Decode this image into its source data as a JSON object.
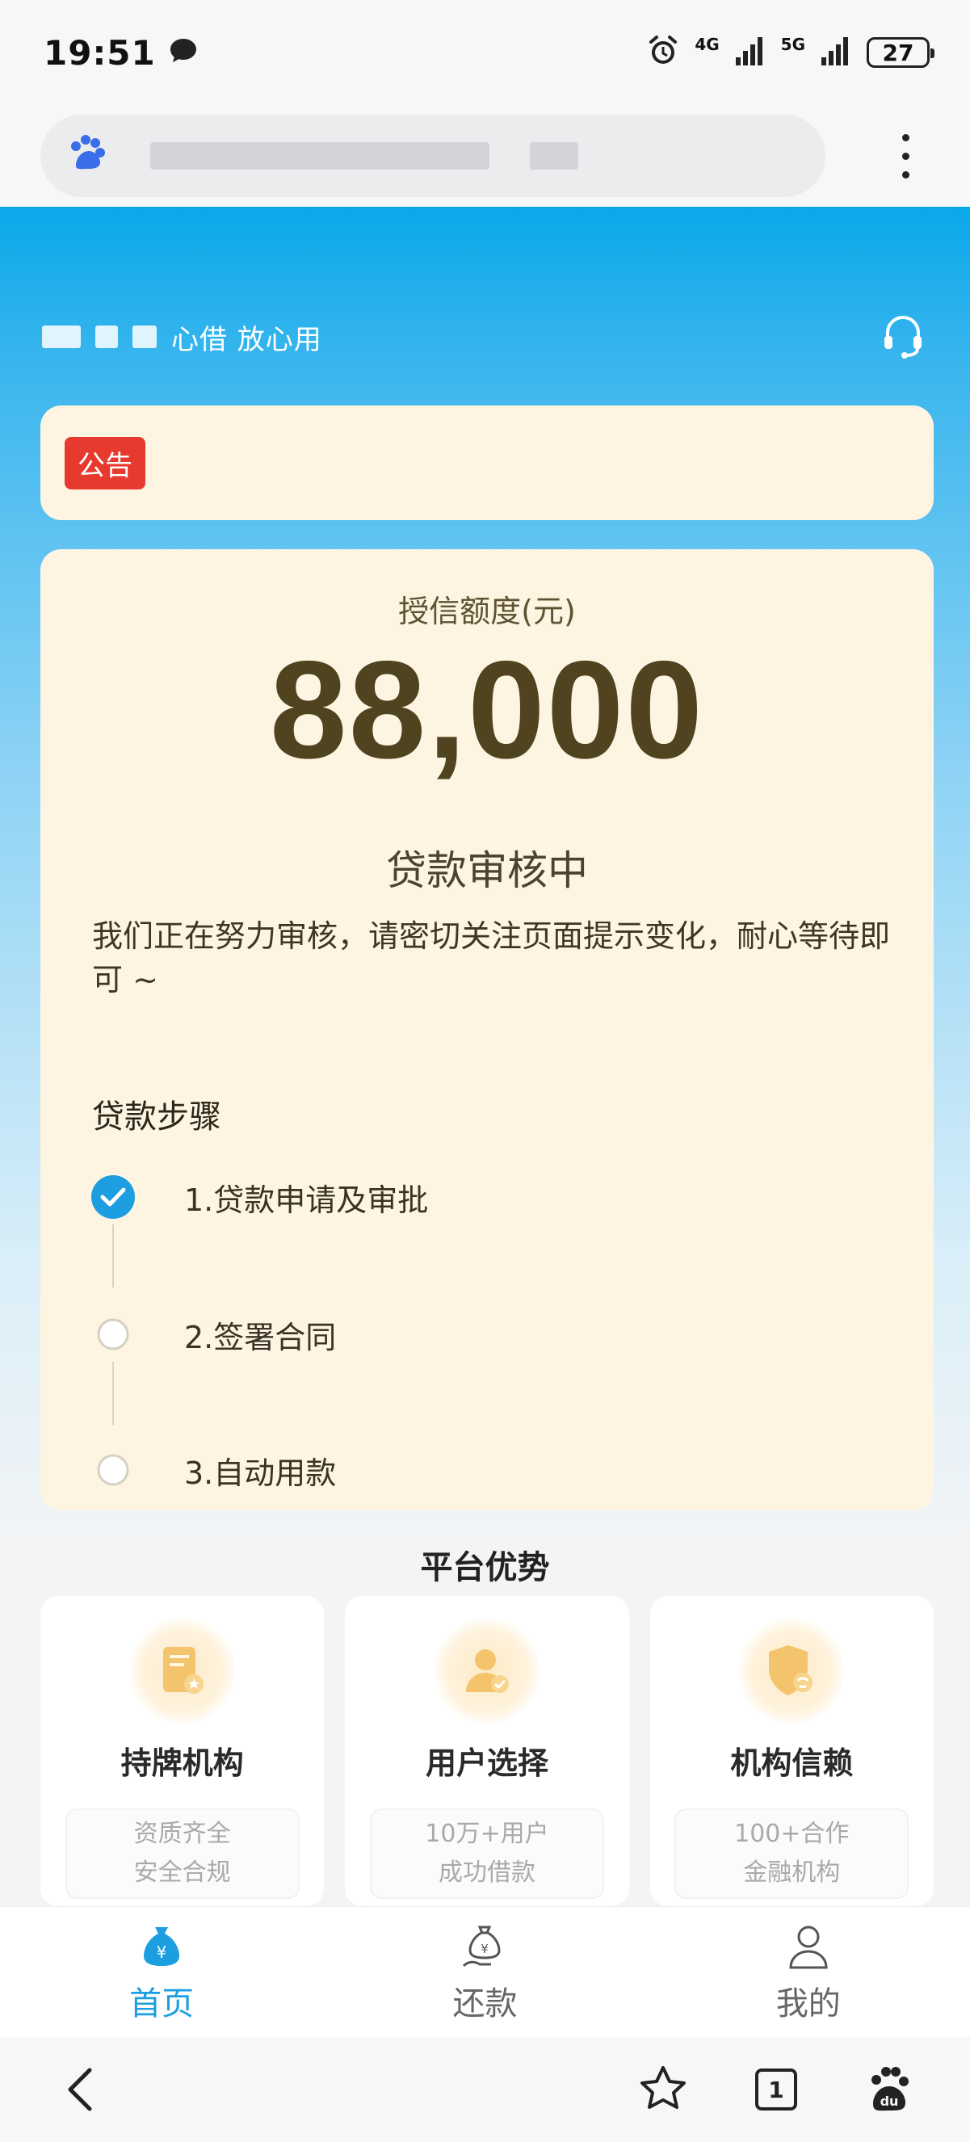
{
  "status_bar": {
    "time": "19:51",
    "net1": "4G",
    "net2": "5G",
    "battery": "27"
  },
  "header": {
    "slogan": "心借 放心用"
  },
  "notice": {
    "tag": "公告"
  },
  "loan": {
    "credit_label": "授信额度(元)",
    "credit_amount": "88,000",
    "review_title": "贷款审核中",
    "review_desc": "我们正在努力审核，请密切关注页面提示变化，耐心等待即可 ~",
    "steps_title": "贷款步骤",
    "steps": [
      {
        "label": "1.贷款申请及审批",
        "done": true
      },
      {
        "label": "2.签署合同",
        "done": false
      },
      {
        "label": "3.自动用款",
        "done": false
      }
    ]
  },
  "advantages": {
    "title": "平台优势",
    "items": [
      {
        "name": "持牌机构",
        "desc_line1": "资质齐全",
        "desc_line2": "安全合规"
      },
      {
        "name": "用户选择",
        "desc_line1": "10万+用户",
        "desc_line2": "成功借款"
      },
      {
        "name": "机构信赖",
        "desc_line1": "100+合作",
        "desc_line2": "金融机构"
      }
    ]
  },
  "bottom_nav": {
    "items": [
      {
        "label": "首页",
        "icon": "money-bag-icon",
        "active": true
      },
      {
        "label": "还款",
        "icon": "repay-icon",
        "active": false
      },
      {
        "label": "我的",
        "icon": "user-icon",
        "active": false
      }
    ]
  },
  "browser_bar": {
    "tab_count": "1"
  },
  "colors": {
    "accent": "#1d9ee0",
    "notice_tag": "#e63a2e",
    "card_bg": "#fdf5e2",
    "amount_text": "#4f4320"
  }
}
